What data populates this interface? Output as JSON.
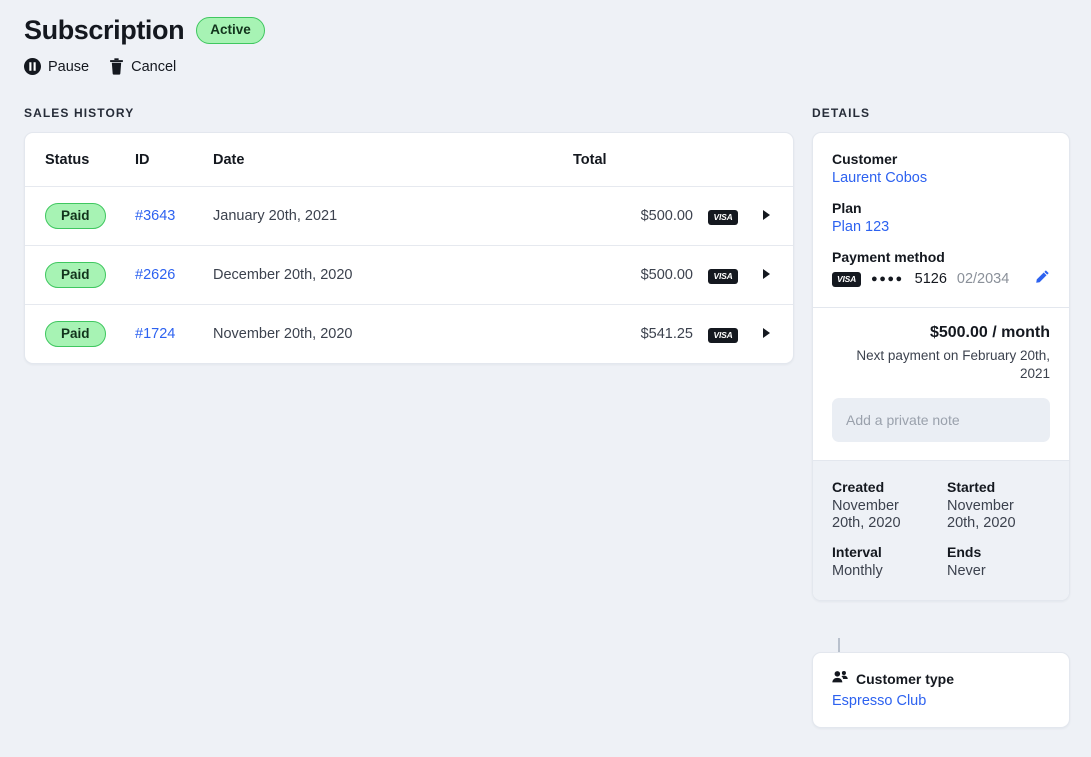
{
  "header": {
    "title": "Subscription",
    "status_badge": "Active",
    "actions": [
      {
        "label": "Pause",
        "icon": "pause-circle-icon"
      },
      {
        "label": "Cancel",
        "icon": "trash-icon"
      }
    ]
  },
  "sales_history": {
    "section_label": "Sales history",
    "columns": [
      "Status",
      "ID",
      "Date",
      "Total"
    ],
    "rows": [
      {
        "status": "Paid",
        "id": "#3643",
        "date": "January 20th, 2021",
        "total": "$500.00",
        "brand": "VISA"
      },
      {
        "status": "Paid",
        "id": "#2626",
        "date": "December 20th, 2020",
        "total": "$500.00",
        "brand": "VISA"
      },
      {
        "status": "Paid",
        "id": "#1724",
        "date": "November 20th, 2020",
        "total": "$541.25",
        "brand": "VISA"
      }
    ]
  },
  "details": {
    "section_label": "Details",
    "customer_label": "Customer",
    "customer_name": "Laurent Cobos",
    "plan_label": "Plan",
    "plan_name": "Plan 123",
    "payment_method_label": "Payment method",
    "card_brand": "VISA",
    "card_dots": "●●●●",
    "card_last4": "5126",
    "card_expiry": "02/2034",
    "price": "$500.00 / month",
    "next_payment": "Next payment on February 20th, 2021",
    "note_placeholder": "Add a private note",
    "created_label": "Created",
    "created_value": "November 20th, 2020",
    "started_label": "Started",
    "started_value": "November 20th, 2020",
    "interval_label": "Interval",
    "interval_value": "Monthly",
    "ends_label": "Ends",
    "ends_value": "Never"
  },
  "customer_type": {
    "label": "Customer type",
    "value": "Espresso Club",
    "icon": "users-icon"
  },
  "colors": {
    "background": "#eef1f6",
    "card": "#ffffff",
    "link": "#2d62f0",
    "badge_green_bg": "#a7f3b4",
    "badge_green_border": "#3fc75f",
    "text": "#14181f",
    "muted": "#8a9099"
  }
}
